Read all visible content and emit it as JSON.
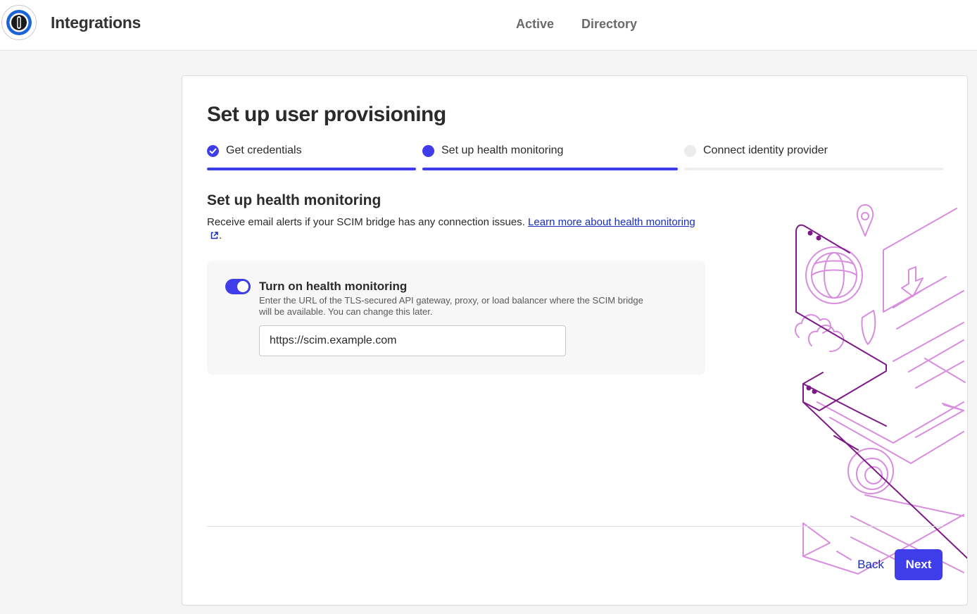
{
  "header": {
    "app_title": "Integrations",
    "logo_icon": "1password-keyhole-icon",
    "tabs": [
      {
        "label": "Active"
      },
      {
        "label": "Directory"
      }
    ]
  },
  "wizard": {
    "title": "Set up user provisioning",
    "steps": [
      {
        "label": "Get credentials",
        "status": "complete",
        "icon": "check-circle-icon"
      },
      {
        "label": "Set up health monitoring",
        "status": "current",
        "icon": "dot-icon"
      },
      {
        "label": "Connect identity provider",
        "status": "upcoming",
        "icon": "dot-icon"
      }
    ],
    "section": {
      "title": "Set up health monitoring",
      "description": "Receive email alerts if your SCIM bridge has any connection issues. ",
      "link_text": "Learn more about health monitoring",
      "link_icon": "external-link-icon",
      "period": "."
    },
    "health_monitoring": {
      "toggle_on": true,
      "label": "Turn on health monitoring",
      "help": "Enter the URL of the TLS-secured API gateway, proxy, or load balancer where the SCIM bridge will be available. You can change this later.",
      "url_value": "https://scim.example.com"
    },
    "footer": {
      "back_label": "Back",
      "next_label": "Next"
    }
  },
  "colors": {
    "accent": "#3e3de9",
    "link": "#1a2fb8",
    "inactive_bar": "#eeeeee",
    "illustration_dark": "#7c1a86",
    "illustration_light": "#d88ddf"
  }
}
